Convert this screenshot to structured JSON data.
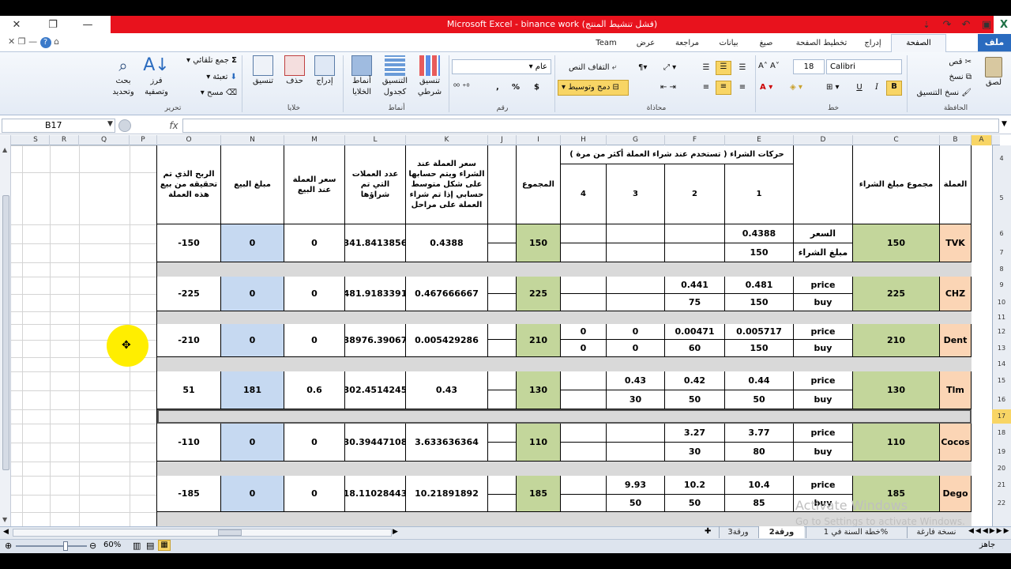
{
  "window": {
    "title": "Microsoft Excel - binance work (فشل تنشيط المنتج)"
  },
  "ribbon_tabs": {
    "file": "ملف",
    "home": "الصفحة الرئيسية",
    "insert": "إدراج",
    "page_layout": "تخطيط الصفحة",
    "formulas": "صيغ",
    "data": "بيانات",
    "review": "مراجعة",
    "view": "عرض",
    "team": "Team"
  },
  "ribbon": {
    "clipboard": {
      "label": "الحافظة",
      "paste": "لصق",
      "cut": "قص",
      "copy": "نسخ",
      "format_painter": "نسخ التنسيق"
    },
    "font": {
      "label": "خط",
      "name": "Calibri",
      "size": "18",
      "bold": "B",
      "italic": "I",
      "underline": "U"
    },
    "alignment": {
      "label": "محاذاة",
      "wrap": "التفاف النص",
      "merge": "دمج وتوسيط"
    },
    "number": {
      "label": "رقم",
      "format": "عام",
      "currency": "$",
      "percent": "%",
      "comma": ","
    },
    "styles": {
      "label": "أنماط",
      "conditional": "تنسيق شرطي",
      "table": "التنسيق كجدول",
      "cell": "أنماط الخلايا"
    },
    "cells": {
      "label": "خلايا",
      "insert": "إدراج",
      "delete": "حذف",
      "format": "تنسيق"
    },
    "editing": {
      "label": "تحرير",
      "autosum": "جمع تلقائي",
      "fill": "تعبئة",
      "clear": "مسح",
      "sort": "فرز وتصفية",
      "find": "بحث وتحديد"
    }
  },
  "formula_bar": {
    "name_box": "B17",
    "fx": "fx",
    "value": ""
  },
  "columns": [
    "A",
    "B",
    "C",
    "D",
    "E",
    "F",
    "G",
    "H",
    "I",
    "J",
    "K",
    "L",
    "M",
    "N",
    "O",
    "P",
    "Q",
    "R",
    "S"
  ],
  "selected_column": "A",
  "rows": [
    "4",
    "5",
    "6",
    "7",
    "8",
    "9",
    "10",
    "11",
    "12",
    "13",
    "14",
    "15",
    "16",
    "17",
    "18",
    "19",
    "20",
    "21",
    "22"
  ],
  "selected_row": "17",
  "headers": {
    "currency": "العملة",
    "total_buy": "مجموع مبلغ الشراء",
    "buy_moves": "حركات الشراء ( تستخدم عند شراء العملة أكثر من مرة )",
    "n1": "1",
    "n2": "2",
    "n3": "3",
    "n4": "4",
    "sum": "المجموع",
    "avg_price": "سعر العملة عند الشراء ويتم حسابها على شكل متوسط حسابي إذا تم شراء العملة على مراحل",
    "coins": "عدد العملات التي تم شراؤها",
    "sell_price": "سعر العملة عند البيع",
    "sell_amount": "مبلغ البيع",
    "profit": "الربح الذي تم تحقيقه من بيع هذه العملة"
  },
  "records": [
    {
      "coin": "TVK",
      "total": "150",
      "l1": "السعر",
      "l2": "مبلغ الشراء",
      "e1": "0.4388",
      "e2": "150",
      "f1": "",
      "f2": "",
      "g1": "",
      "g2": "",
      "h1": "",
      "h2": "",
      "sum": "150",
      "avg": "0.4388",
      "coins": "341.8413856",
      "sell_price": "0",
      "sell_amount": "0",
      "profit": "-150"
    },
    {
      "coin": "CHZ",
      "total": "225",
      "l1": "price",
      "l2": "buy",
      "e1": "0.481",
      "e2": "150",
      "f1": "0.441",
      "f2": "75",
      "g1": "",
      "g2": "",
      "h1": "",
      "h2": "",
      "sum": "225",
      "avg": "0.467666667",
      "coins": "481.9183391",
      "sell_price": "0",
      "sell_amount": "0",
      "profit": "-225"
    },
    {
      "coin": "Dent",
      "total": "210",
      "l1": "price",
      "l2": "buy",
      "e1": "0.005717",
      "e2": "150",
      "f1": "0.00471",
      "f2": "60",
      "g1": "0",
      "g2": "0",
      "h1": "0",
      "h2": "0",
      "sum": "210",
      "avg": "0.005429286",
      "coins": "38976.39067",
      "sell_price": "0",
      "sell_amount": "0",
      "profit": "-210"
    },
    {
      "coin": "Tlm",
      "total": "130",
      "l1": "price",
      "l2": "buy",
      "e1": "0.44",
      "e2": "50",
      "f1": "0.42",
      "f2": "50",
      "g1": "0.43",
      "g2": "30",
      "h1": "",
      "h2": "",
      "sum": "130",
      "avg": "0.43",
      "coins": "302.4514245",
      "sell_price": "0.6",
      "sell_amount": "181",
      "profit": "51"
    },
    {
      "coin": "Cocos",
      "total": "110",
      "l1": "price",
      "l2": "buy",
      "e1": "3.77",
      "e2": "80",
      "f1": "3.27",
      "f2": "30",
      "g1": "",
      "g2": "",
      "h1": "",
      "h2": "",
      "sum": "110",
      "avg": "3.633636364",
      "coins": "30.39447108",
      "sell_price": "0",
      "sell_amount": "0",
      "profit": "-110"
    },
    {
      "coin": "Dego",
      "total": "185",
      "l1": "price",
      "l2": "buy",
      "e1": "10.4",
      "e2": "85",
      "f1": "10.2",
      "f2": "50",
      "g1": "9.93",
      "g2": "50",
      "h1": "",
      "h2": "",
      "sum": "185",
      "avg": "10.21891892",
      "coins": "18.11028443",
      "sell_price": "0",
      "sell_amount": "0",
      "profit": "-185"
    }
  ],
  "sheet_tabs": [
    "نسخة فارغة",
    "خطة السنة في 1%",
    "ورقة2",
    "ورقة3"
  ],
  "active_sheet": "ورقة2",
  "status": {
    "ready": "جاهز",
    "zoom": "60%"
  },
  "watermark": {
    "line1": "Activate Windows",
    "line2": "Go to Settings to activate Windows."
  },
  "colors": {
    "green": "#c3d69b",
    "blue": "#c6d9f1",
    "peach": "#fbd5b5",
    "title_red": "#e8121d",
    "file_blue": "#2a6bbf"
  }
}
